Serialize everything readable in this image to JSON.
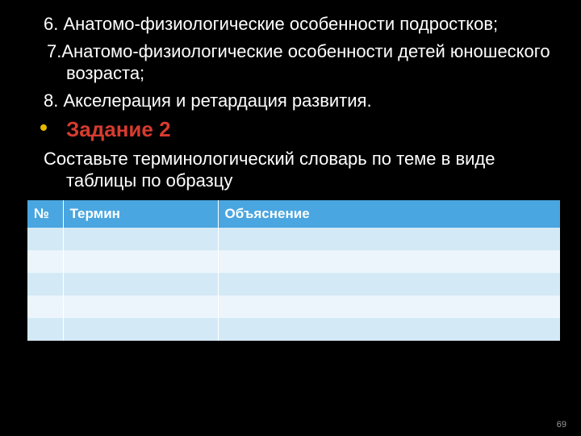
{
  "slide": {
    "item6": "6. Анатомо-физиологические особенности подростков;",
    "item7": " 7.Анатомо-физиологические особенности детей юношеского возраста;",
    "item8": "8. Акселерация и ретардация развития.",
    "task_heading": "Задание 2",
    "task_text": "Составьте терминологический словарь по теме в виде таблицы по образцу",
    "page_number": "69"
  },
  "table": {
    "headers": {
      "num": "№",
      "term": "Термин",
      "explanation": "Объяснение"
    },
    "rows": [
      {
        "num": "",
        "term": "",
        "explanation": ""
      },
      {
        "num": "",
        "term": "",
        "explanation": ""
      },
      {
        "num": "",
        "term": "",
        "explanation": ""
      },
      {
        "num": "",
        "term": "",
        "explanation": ""
      },
      {
        "num": "",
        "term": "",
        "explanation": ""
      }
    ]
  },
  "colors": {
    "accent_red": "#d73b2f",
    "bullet_gold": "#e5b800",
    "table_header_blue": "#4aa6e0",
    "row_light": "#ecf5fb",
    "row_alt": "#d4e9f6"
  }
}
